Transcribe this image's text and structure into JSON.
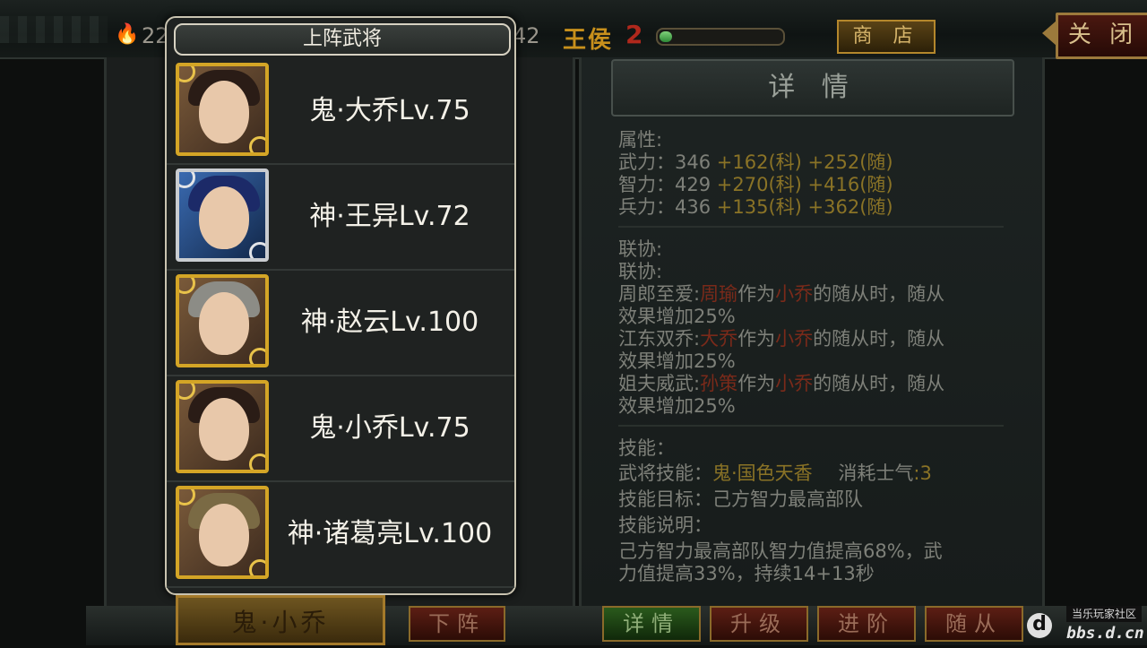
{
  "topbar": {
    "resource_value": "22",
    "resource_value2": "42",
    "rank_name": "王侯",
    "rank_level": "2",
    "exp_fraction": 0.1,
    "shop_label": "商 店",
    "close_label": "关 闭"
  },
  "popup": {
    "title": "上阵武将",
    "generals": [
      {
        "name": "鬼·大乔Lv.75"
      },
      {
        "name": "神·王异Lv.72"
      },
      {
        "name": "神·赵云Lv.100"
      },
      {
        "name": "鬼·小乔Lv.75"
      },
      {
        "name": "神·诸葛亮Lv.100"
      }
    ]
  },
  "detail": {
    "header": "详 情",
    "attr_title": "属性:",
    "attrs": [
      {
        "label": "武力：346",
        "plus1": "+162(科)",
        "plus2": "+252(随)"
      },
      {
        "label": "智力：429",
        "plus1": "+270(科)",
        "plus2": "+416(随)"
      },
      {
        "label": "兵力：436",
        "plus1": "+135(科)",
        "plus2": "+362(随)"
      }
    ],
    "synergy_title1": "联协:",
    "synergy_title2": "联协:",
    "synergies": [
      {
        "name": "周郎至爱:",
        "partner": "周瑜",
        "mid": "作为",
        "target": "小乔",
        "rest": "的随从时，随从",
        "line2": "效果增加25%"
      },
      {
        "name": "江东双乔:",
        "partner": "大乔",
        "mid": "作为",
        "target": "小乔",
        "rest": "的随从时，随从",
        "line2": "效果增加25%"
      },
      {
        "name": "姐夫威武:",
        "partner": "孙策",
        "mid": "作为",
        "target": "小乔",
        "rest": "的随从时，随从",
        "line2": "效果增加25%"
      }
    ],
    "skill_title": "技能：",
    "skill_label": "武将技能：",
    "skill_name": "鬼·国色天香",
    "cost_label": "消耗士气",
    "cost_value": ":3",
    "target_line": "技能目标：己方智力最高部队",
    "desc_title": "技能说明：",
    "desc_line1": "己方智力最高部队智力值提高68%，武",
    "desc_line2": "力值提高33%，持续14+13秒"
  },
  "bottom": {
    "selected_general": "鬼·小乔",
    "btn_remove": "下阵",
    "btn_detail": "详情",
    "btn_upgrade": "升级",
    "btn_advance": "进阶",
    "btn_follower": "随从"
  },
  "watermark": {
    "line1": "当乐玩家社区",
    "line2": "bbs.d.cn",
    "logo": "d"
  }
}
